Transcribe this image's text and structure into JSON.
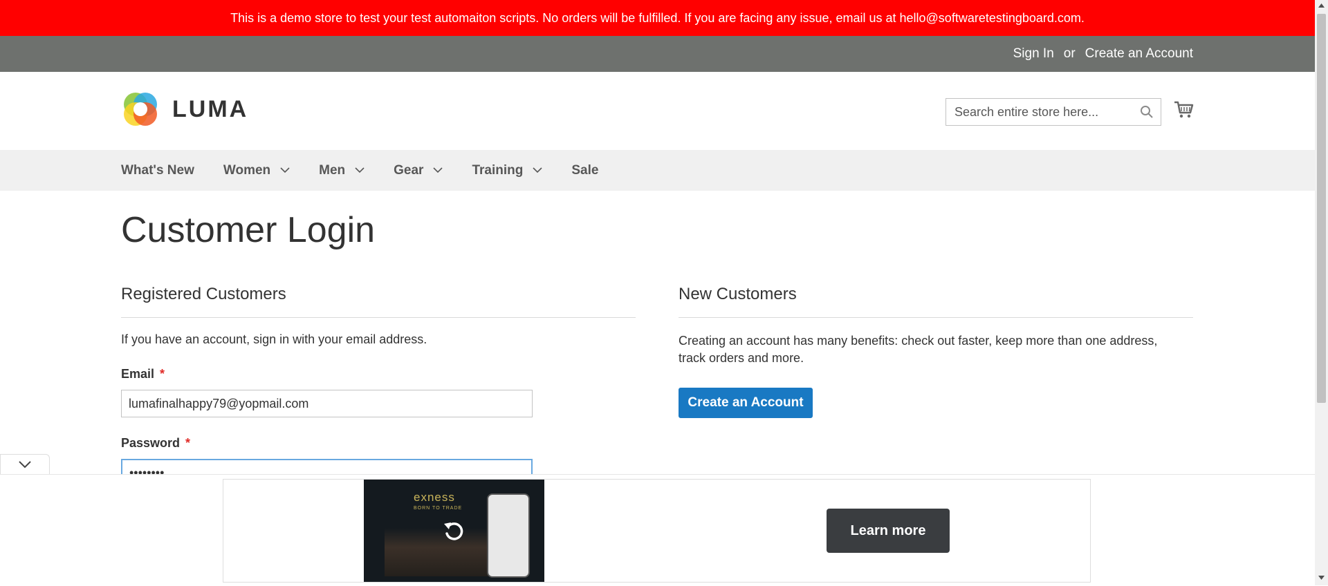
{
  "notice": "This is a demo store to test your test automaiton scripts. No orders will be fulfilled. If you are facing any issue, email us at hello@softwaretestingboard.com.",
  "panel": {
    "sign_in": "Sign In",
    "or": "or",
    "create_account": "Create an Account"
  },
  "header": {
    "logo_text": "LUMA",
    "search_placeholder": "Search entire store here...",
    "search_icon": "search-icon",
    "cart_icon": "cart-icon"
  },
  "nav": {
    "items": [
      {
        "label": "What's New",
        "has_dropdown": false
      },
      {
        "label": "Women",
        "has_dropdown": true
      },
      {
        "label": "Men",
        "has_dropdown": true
      },
      {
        "label": "Gear",
        "has_dropdown": true
      },
      {
        "label": "Training",
        "has_dropdown": true
      },
      {
        "label": "Sale",
        "has_dropdown": false
      }
    ]
  },
  "page": {
    "title": "Customer Login"
  },
  "registered": {
    "title": "Registered Customers",
    "note": "If you have an account, sign in with your email address.",
    "email_label": "Email",
    "email_value": "lumafinalhappy79@yopmail.com",
    "password_label": "Password",
    "password_value": "********",
    "required_mark": "*"
  },
  "new_customers": {
    "title": "New Customers",
    "note": "Creating an account has many benefits: check out faster, keep more than one address, track orders and more.",
    "button": "Create an Account"
  },
  "ad": {
    "brand": "exness",
    "tagline": "BORN TO TRADE",
    "button": "Learn more",
    "replay_icon": "replay-icon",
    "collapse_icon": "chevron-down-icon"
  },
  "colors": {
    "notice_bg": "#ff0000",
    "panel_bg": "#6e716e",
    "nav_bg": "#f0f0f0",
    "primary": "#1979c3",
    "required": "#e02b27"
  }
}
